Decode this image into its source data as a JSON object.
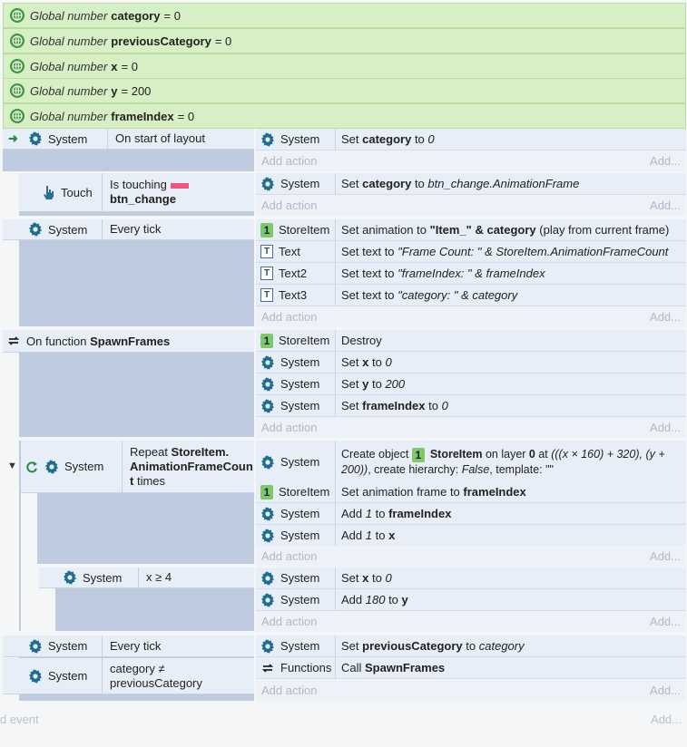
{
  "globals": [
    {
      "prefix": "Global number",
      "name": "category",
      "suffix": "= 0"
    },
    {
      "prefix": "Global number",
      "name": "previousCategory",
      "suffix": "= 0"
    },
    {
      "prefix": "Global number",
      "name": "x",
      "suffix": "= 0"
    },
    {
      "prefix": "Global number",
      "name": "y",
      "suffix": "= 200"
    },
    {
      "prefix": "Global number",
      "name": "frameIndex",
      "suffix": "= 0"
    }
  ],
  "ev1": {
    "cond_obj": "System",
    "cond_text": "On start of layout",
    "act_obj": "System",
    "act_pre": "Set ",
    "act_b": "category",
    "act_mid": " to ",
    "act_i": "0"
  },
  "ev2": {
    "cond_obj": "Touch",
    "cond_text1": "Is touching",
    "cond_text2": "btn_change",
    "act_obj": "System",
    "act_pre": "Set ",
    "act_b": "category",
    "act_mid": " to ",
    "act_i": "btn_change.AnimationFrame"
  },
  "ev3": {
    "cond_obj": "System",
    "cond_text": "Every tick",
    "a1_obj": "StoreItem",
    "a1_pre": "Set animation to ",
    "a1_b": "\"Item_\" & category",
    "a1_post": " (play from current frame)",
    "a2_obj": "Text",
    "a2_pre": "Set text to ",
    "a2_i": "\"Frame Count: \" & StoreItem.AnimationFrameCount",
    "a3_obj": "Text2",
    "a3_pre": "Set text to ",
    "a3_i": "\"frameIndex: \" & frameIndex",
    "a4_obj": "Text3",
    "a4_pre": "Set text to ",
    "a4_i": "\"category: \" & category"
  },
  "ev4": {
    "cond_pre": "On function ",
    "cond_b": "SpawnFrames",
    "a1_obj": "StoreItem",
    "a1_text": "Destroy",
    "a2_obj": "System",
    "a2_pre": "Set ",
    "a2_b": "x",
    "a2_mid": " to ",
    "a2_i": "0",
    "a3_obj": "System",
    "a3_pre": "Set ",
    "a3_b": "y",
    "a3_mid": " to ",
    "a3_i": "200",
    "a4_obj": "System",
    "a4_pre": "Set ",
    "a4_b": "frameIndex",
    "a4_mid": " to ",
    "a4_i": "0"
  },
  "ev5": {
    "cond_obj": "System",
    "cond_pre": "Repeat ",
    "cond_b1": "StoreItem.",
    "cond_b2": "AnimationFrameCoun",
    "cond_b3": "t",
    "cond_post": " times",
    "a1_obj": "System",
    "a1_pre": "Create object ",
    "a1_b": "StoreItem",
    "a1_mid": " on layer ",
    "a1_b2": "0",
    "a1_mid2": " at ",
    "a1_i": "(((x × 160) + 320), (y +",
    "a1_i2": "200))",
    "a1_post": ", create hierarchy: ",
    "a1_i3": "False",
    "a1_post2": ", template: \"\"",
    "a2_obj": "StoreItem",
    "a2_pre": "Set animation frame to ",
    "a2_b": "frameIndex",
    "a3_obj": "System",
    "a3_pre": "Add ",
    "a3_i": "1",
    "a3_mid": " to ",
    "a3_b": "frameIndex",
    "a4_obj": "System",
    "a4_pre": "Add ",
    "a4_i": "1",
    "a4_mid": " to ",
    "a4_b": "x"
  },
  "ev6": {
    "cond_obj": "System",
    "cond_text": "x ≥ 4",
    "a1_obj": "System",
    "a1_pre": "Set ",
    "a1_b": "x",
    "a1_mid": " to ",
    "a1_i": "0",
    "a2_obj": "System",
    "a2_pre": "Add ",
    "a2_i": "180",
    "a2_mid": " to ",
    "a2_b": "y"
  },
  "ev7": {
    "c1_obj": "System",
    "c1_text": "Every tick",
    "c2_obj": "System",
    "c2_text1": "category ≠",
    "c2_text2": "previousCategory",
    "a1_obj": "System",
    "a1_pre": "Set ",
    "a1_b": "previousCategory",
    "a1_mid": " to ",
    "a1_i": "category",
    "a2_obj": "Functions",
    "a2_pre": "Call ",
    "a2_b": "SpawnFrames"
  },
  "ui": {
    "add_action": "Add action",
    "add_short": "Add...",
    "add_event": "d event",
    "one_badge": "1",
    "text_badge": "T"
  },
  "colors": {
    "gear": "#1e6f8f",
    "globe": "#3e9a3a",
    "touch": "#2a6f8f",
    "arrow": "#2a8a4a",
    "touch_swatch": "#f0557e"
  }
}
